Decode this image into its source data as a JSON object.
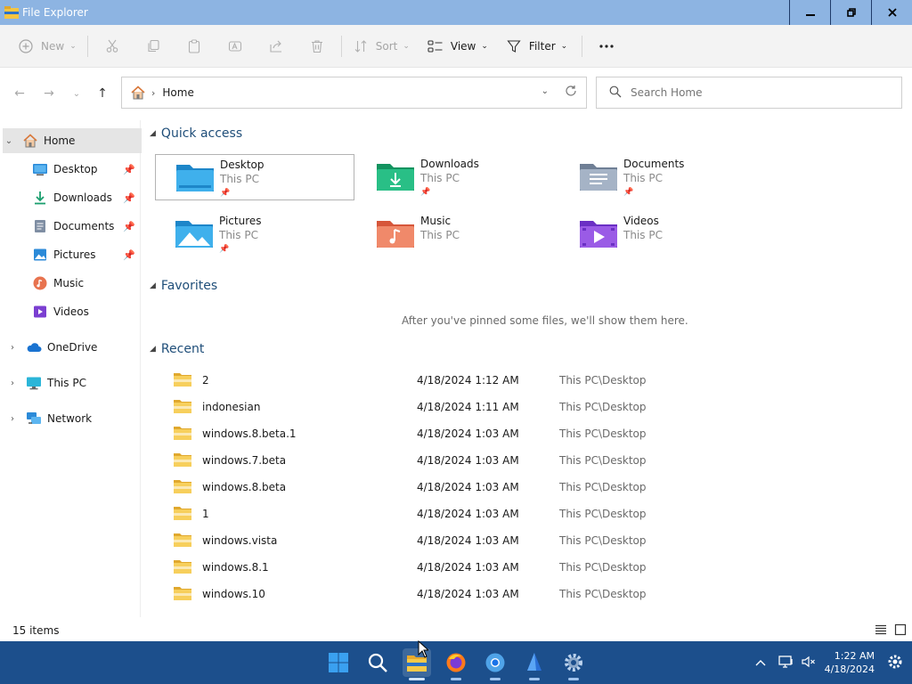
{
  "window": {
    "title": "File Explorer"
  },
  "commandbar": {
    "new_label": "New",
    "sort_label": "Sort",
    "view_label": "View",
    "filter_label": "Filter"
  },
  "address": {
    "crumb": "Home"
  },
  "search": {
    "placeholder": "Search Home"
  },
  "sidebar": {
    "items": [
      {
        "label": "Home"
      },
      {
        "label": "Desktop"
      },
      {
        "label": "Downloads"
      },
      {
        "label": "Documents"
      },
      {
        "label": "Pictures"
      },
      {
        "label": "Music"
      },
      {
        "label": "Videos"
      },
      {
        "label": "OneDrive"
      },
      {
        "label": "This PC"
      },
      {
        "label": "Network"
      }
    ]
  },
  "quick_access": {
    "heading": "Quick access",
    "tiles": [
      {
        "name": "Desktop",
        "location": "This PC"
      },
      {
        "name": "Downloads",
        "location": "This PC"
      },
      {
        "name": "Documents",
        "location": "This PC"
      },
      {
        "name": "Pictures",
        "location": "This PC"
      },
      {
        "name": "Music",
        "location": "This PC"
      },
      {
        "name": "Videos",
        "location": "This PC"
      }
    ]
  },
  "favorites": {
    "heading": "Favorites",
    "empty_message": "After you've pinned some files, we'll show them here."
  },
  "recent": {
    "heading": "Recent",
    "rows": [
      {
        "name": "2",
        "date": "4/18/2024 1:12 AM",
        "location": "This PC\\Desktop"
      },
      {
        "name": "indonesian",
        "date": "4/18/2024 1:11 AM",
        "location": "This PC\\Desktop"
      },
      {
        "name": "windows.8.beta.1",
        "date": "4/18/2024 1:03 AM",
        "location": "This PC\\Desktop"
      },
      {
        "name": "windows.7.beta",
        "date": "4/18/2024 1:03 AM",
        "location": "This PC\\Desktop"
      },
      {
        "name": "windows.8.beta",
        "date": "4/18/2024 1:03 AM",
        "location": "This PC\\Desktop"
      },
      {
        "name": "1",
        "date": "4/18/2024 1:03 AM",
        "location": "This PC\\Desktop"
      },
      {
        "name": "windows.vista",
        "date": "4/18/2024 1:03 AM",
        "location": "This PC\\Desktop"
      },
      {
        "name": "windows.8.1",
        "date": "4/18/2024 1:03 AM",
        "location": "This PC\\Desktop"
      },
      {
        "name": "windows.10",
        "date": "4/18/2024 1:03 AM",
        "location": "This PC\\Desktop"
      }
    ]
  },
  "status": {
    "item_count": "15 items"
  },
  "taskbar": {
    "time": "1:22 AM",
    "date": "4/18/2024"
  },
  "colors": {
    "accent": "#1f4e79",
    "titlebar": "#8db4e2",
    "taskbar": "#1c4f8c"
  }
}
